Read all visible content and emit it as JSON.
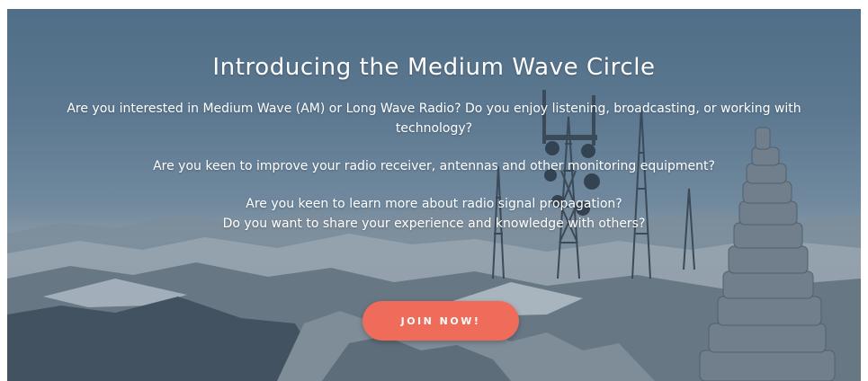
{
  "hero": {
    "title": "Introducing the Medium Wave Circle",
    "paragraph_1": "Are you interested in Medium Wave (AM) or Long Wave Radio? Do you enjoy listening, broadcasting, or working with technology?",
    "paragraph_2": "Are you keen to improve your radio receiver, antennas and other monitoring equipment?",
    "paragraph_3_line_1": "Are you keen to learn more about radio signal propagation?",
    "paragraph_3_line_2": "Do you want to share your experience and knowledge with others?",
    "join_button_label": "JOIN NOW!"
  },
  "colors": {
    "button": "#ef6c5a",
    "text": "#ffffff",
    "sky": "#6e8aa2"
  }
}
